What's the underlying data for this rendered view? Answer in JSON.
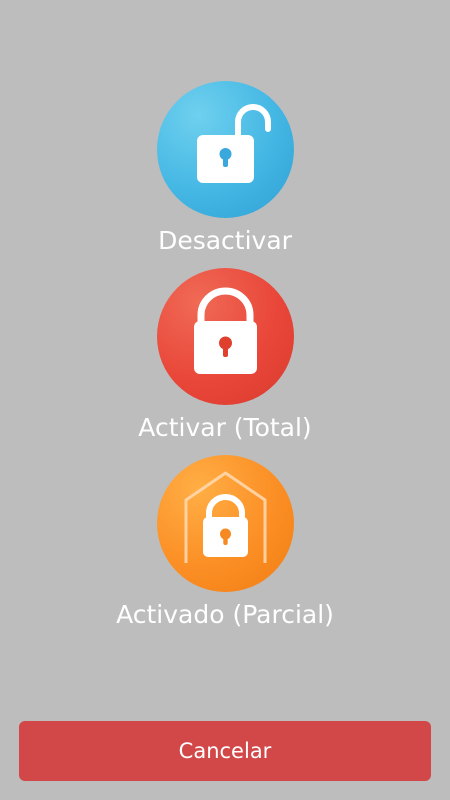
{
  "options": [
    {
      "label": "Desactivar",
      "icon": "unlocked-padlock-icon",
      "color": "#44b7e4"
    },
    {
      "label": "Activar (Total)",
      "icon": "locked-padlock-icon",
      "color": "#e9473a"
    },
    {
      "label": "Activado (Parcial)",
      "icon": "house-padlock-icon",
      "color": "#fb8f25"
    }
  ],
  "cancel_button": {
    "label": "Cancelar",
    "color": "#d24848"
  },
  "background_color": "#bdbdbd"
}
